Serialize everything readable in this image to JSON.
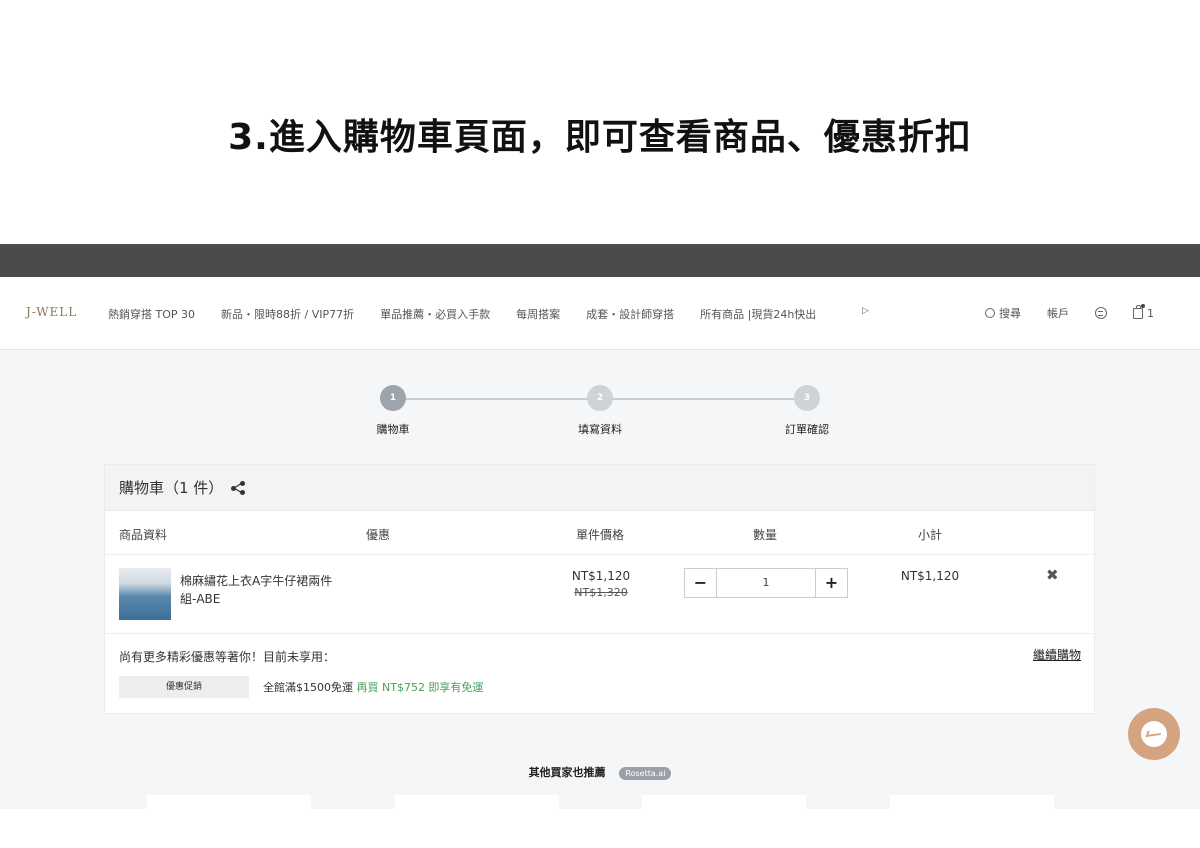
{
  "slide_title": "3.進入購物車頁面，即可查看商品、優惠折扣",
  "nav": {
    "logo": "J-WELL",
    "items": [
      "熱銷穿搭 TOP 30",
      "新品・限時88折 / VIP77折",
      "單品推薦・必買入手款",
      "每周搭案",
      "成套・設計師穿搭",
      "所有商品 |現貨24h快出"
    ],
    "more_arrow": "▷",
    "search_label": "搜尋",
    "account_label": "帳戶",
    "cart_count": "1"
  },
  "steps": [
    {
      "number": "1",
      "label": "購物車",
      "active": true
    },
    {
      "number": "2",
      "label": "填寫資料",
      "active": false
    },
    {
      "number": "3",
      "label": "訂單確認",
      "active": false
    }
  ],
  "colors": {
    "step_active": "#9ea4ac",
    "step_inactive": "#cfd2d6",
    "promo_green": "#4a9f5a",
    "messenger": "#d4a481"
  },
  "cart": {
    "title": "購物車（1 件）",
    "columns": {
      "info": "商品資料",
      "promo": "優惠",
      "unit_price": "單件價格",
      "qty": "數量",
      "subtotal": "小計"
    },
    "item": {
      "name": "棉麻繡花上衣A字牛仔裙兩件組-ABE",
      "price": "NT$1,120",
      "original_price": "NT$1,320",
      "quantity": "1",
      "subtotal": "NT$1,120",
      "minus": "−",
      "plus": "+",
      "remove": "✖"
    },
    "promo_note": "尚有更多精彩優惠等著你！目前未享用：",
    "continue_shopping": "繼續購物",
    "promo_tag": "優惠促銷",
    "promo_text": "全館滿$1500免運",
    "promo_highlight": "再買 NT$752 即享有免運"
  },
  "recommend": {
    "title": "其他買家也推薦",
    "badge": "Rosetta.ai"
  }
}
